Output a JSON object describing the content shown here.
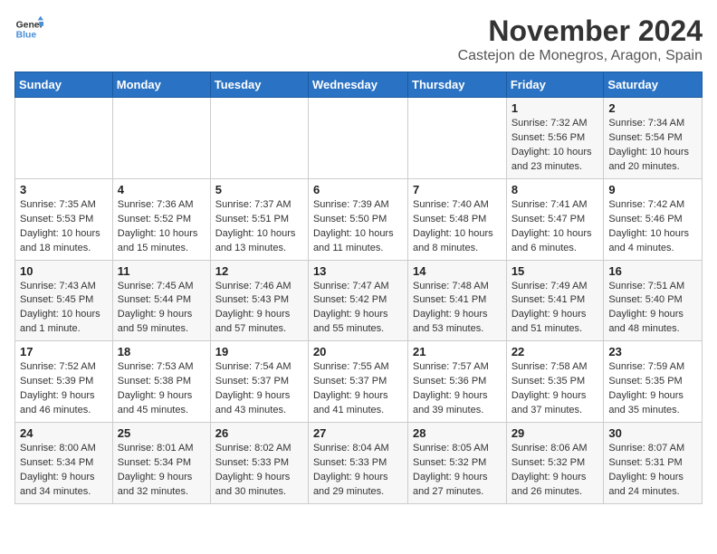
{
  "logo": {
    "line1": "General",
    "line2": "Blue"
  },
  "title": "November 2024",
  "location": "Castejon de Monegros, Aragon, Spain",
  "weekdays": [
    "Sunday",
    "Monday",
    "Tuesday",
    "Wednesday",
    "Thursday",
    "Friday",
    "Saturday"
  ],
  "weeks": [
    [
      {
        "day": "",
        "info": ""
      },
      {
        "day": "",
        "info": ""
      },
      {
        "day": "",
        "info": ""
      },
      {
        "day": "",
        "info": ""
      },
      {
        "day": "",
        "info": ""
      },
      {
        "day": "1",
        "info": "Sunrise: 7:32 AM\nSunset: 5:56 PM\nDaylight: 10 hours and 23 minutes."
      },
      {
        "day": "2",
        "info": "Sunrise: 7:34 AM\nSunset: 5:54 PM\nDaylight: 10 hours and 20 minutes."
      }
    ],
    [
      {
        "day": "3",
        "info": "Sunrise: 7:35 AM\nSunset: 5:53 PM\nDaylight: 10 hours and 18 minutes."
      },
      {
        "day": "4",
        "info": "Sunrise: 7:36 AM\nSunset: 5:52 PM\nDaylight: 10 hours and 15 minutes."
      },
      {
        "day": "5",
        "info": "Sunrise: 7:37 AM\nSunset: 5:51 PM\nDaylight: 10 hours and 13 minutes."
      },
      {
        "day": "6",
        "info": "Sunrise: 7:39 AM\nSunset: 5:50 PM\nDaylight: 10 hours and 11 minutes."
      },
      {
        "day": "7",
        "info": "Sunrise: 7:40 AM\nSunset: 5:48 PM\nDaylight: 10 hours and 8 minutes."
      },
      {
        "day": "8",
        "info": "Sunrise: 7:41 AM\nSunset: 5:47 PM\nDaylight: 10 hours and 6 minutes."
      },
      {
        "day": "9",
        "info": "Sunrise: 7:42 AM\nSunset: 5:46 PM\nDaylight: 10 hours and 4 minutes."
      }
    ],
    [
      {
        "day": "10",
        "info": "Sunrise: 7:43 AM\nSunset: 5:45 PM\nDaylight: 10 hours and 1 minute."
      },
      {
        "day": "11",
        "info": "Sunrise: 7:45 AM\nSunset: 5:44 PM\nDaylight: 9 hours and 59 minutes."
      },
      {
        "day": "12",
        "info": "Sunrise: 7:46 AM\nSunset: 5:43 PM\nDaylight: 9 hours and 57 minutes."
      },
      {
        "day": "13",
        "info": "Sunrise: 7:47 AM\nSunset: 5:42 PM\nDaylight: 9 hours and 55 minutes."
      },
      {
        "day": "14",
        "info": "Sunrise: 7:48 AM\nSunset: 5:41 PM\nDaylight: 9 hours and 53 minutes."
      },
      {
        "day": "15",
        "info": "Sunrise: 7:49 AM\nSunset: 5:41 PM\nDaylight: 9 hours and 51 minutes."
      },
      {
        "day": "16",
        "info": "Sunrise: 7:51 AM\nSunset: 5:40 PM\nDaylight: 9 hours and 48 minutes."
      }
    ],
    [
      {
        "day": "17",
        "info": "Sunrise: 7:52 AM\nSunset: 5:39 PM\nDaylight: 9 hours and 46 minutes."
      },
      {
        "day": "18",
        "info": "Sunrise: 7:53 AM\nSunset: 5:38 PM\nDaylight: 9 hours and 45 minutes."
      },
      {
        "day": "19",
        "info": "Sunrise: 7:54 AM\nSunset: 5:37 PM\nDaylight: 9 hours and 43 minutes."
      },
      {
        "day": "20",
        "info": "Sunrise: 7:55 AM\nSunset: 5:37 PM\nDaylight: 9 hours and 41 minutes."
      },
      {
        "day": "21",
        "info": "Sunrise: 7:57 AM\nSunset: 5:36 PM\nDaylight: 9 hours and 39 minutes."
      },
      {
        "day": "22",
        "info": "Sunrise: 7:58 AM\nSunset: 5:35 PM\nDaylight: 9 hours and 37 minutes."
      },
      {
        "day": "23",
        "info": "Sunrise: 7:59 AM\nSunset: 5:35 PM\nDaylight: 9 hours and 35 minutes."
      }
    ],
    [
      {
        "day": "24",
        "info": "Sunrise: 8:00 AM\nSunset: 5:34 PM\nDaylight: 9 hours and 34 minutes."
      },
      {
        "day": "25",
        "info": "Sunrise: 8:01 AM\nSunset: 5:34 PM\nDaylight: 9 hours and 32 minutes."
      },
      {
        "day": "26",
        "info": "Sunrise: 8:02 AM\nSunset: 5:33 PM\nDaylight: 9 hours and 30 minutes."
      },
      {
        "day": "27",
        "info": "Sunrise: 8:04 AM\nSunset: 5:33 PM\nDaylight: 9 hours and 29 minutes."
      },
      {
        "day": "28",
        "info": "Sunrise: 8:05 AM\nSunset: 5:32 PM\nDaylight: 9 hours and 27 minutes."
      },
      {
        "day": "29",
        "info": "Sunrise: 8:06 AM\nSunset: 5:32 PM\nDaylight: 9 hours and 26 minutes."
      },
      {
        "day": "30",
        "info": "Sunrise: 8:07 AM\nSunset: 5:31 PM\nDaylight: 9 hours and 24 minutes."
      }
    ]
  ]
}
